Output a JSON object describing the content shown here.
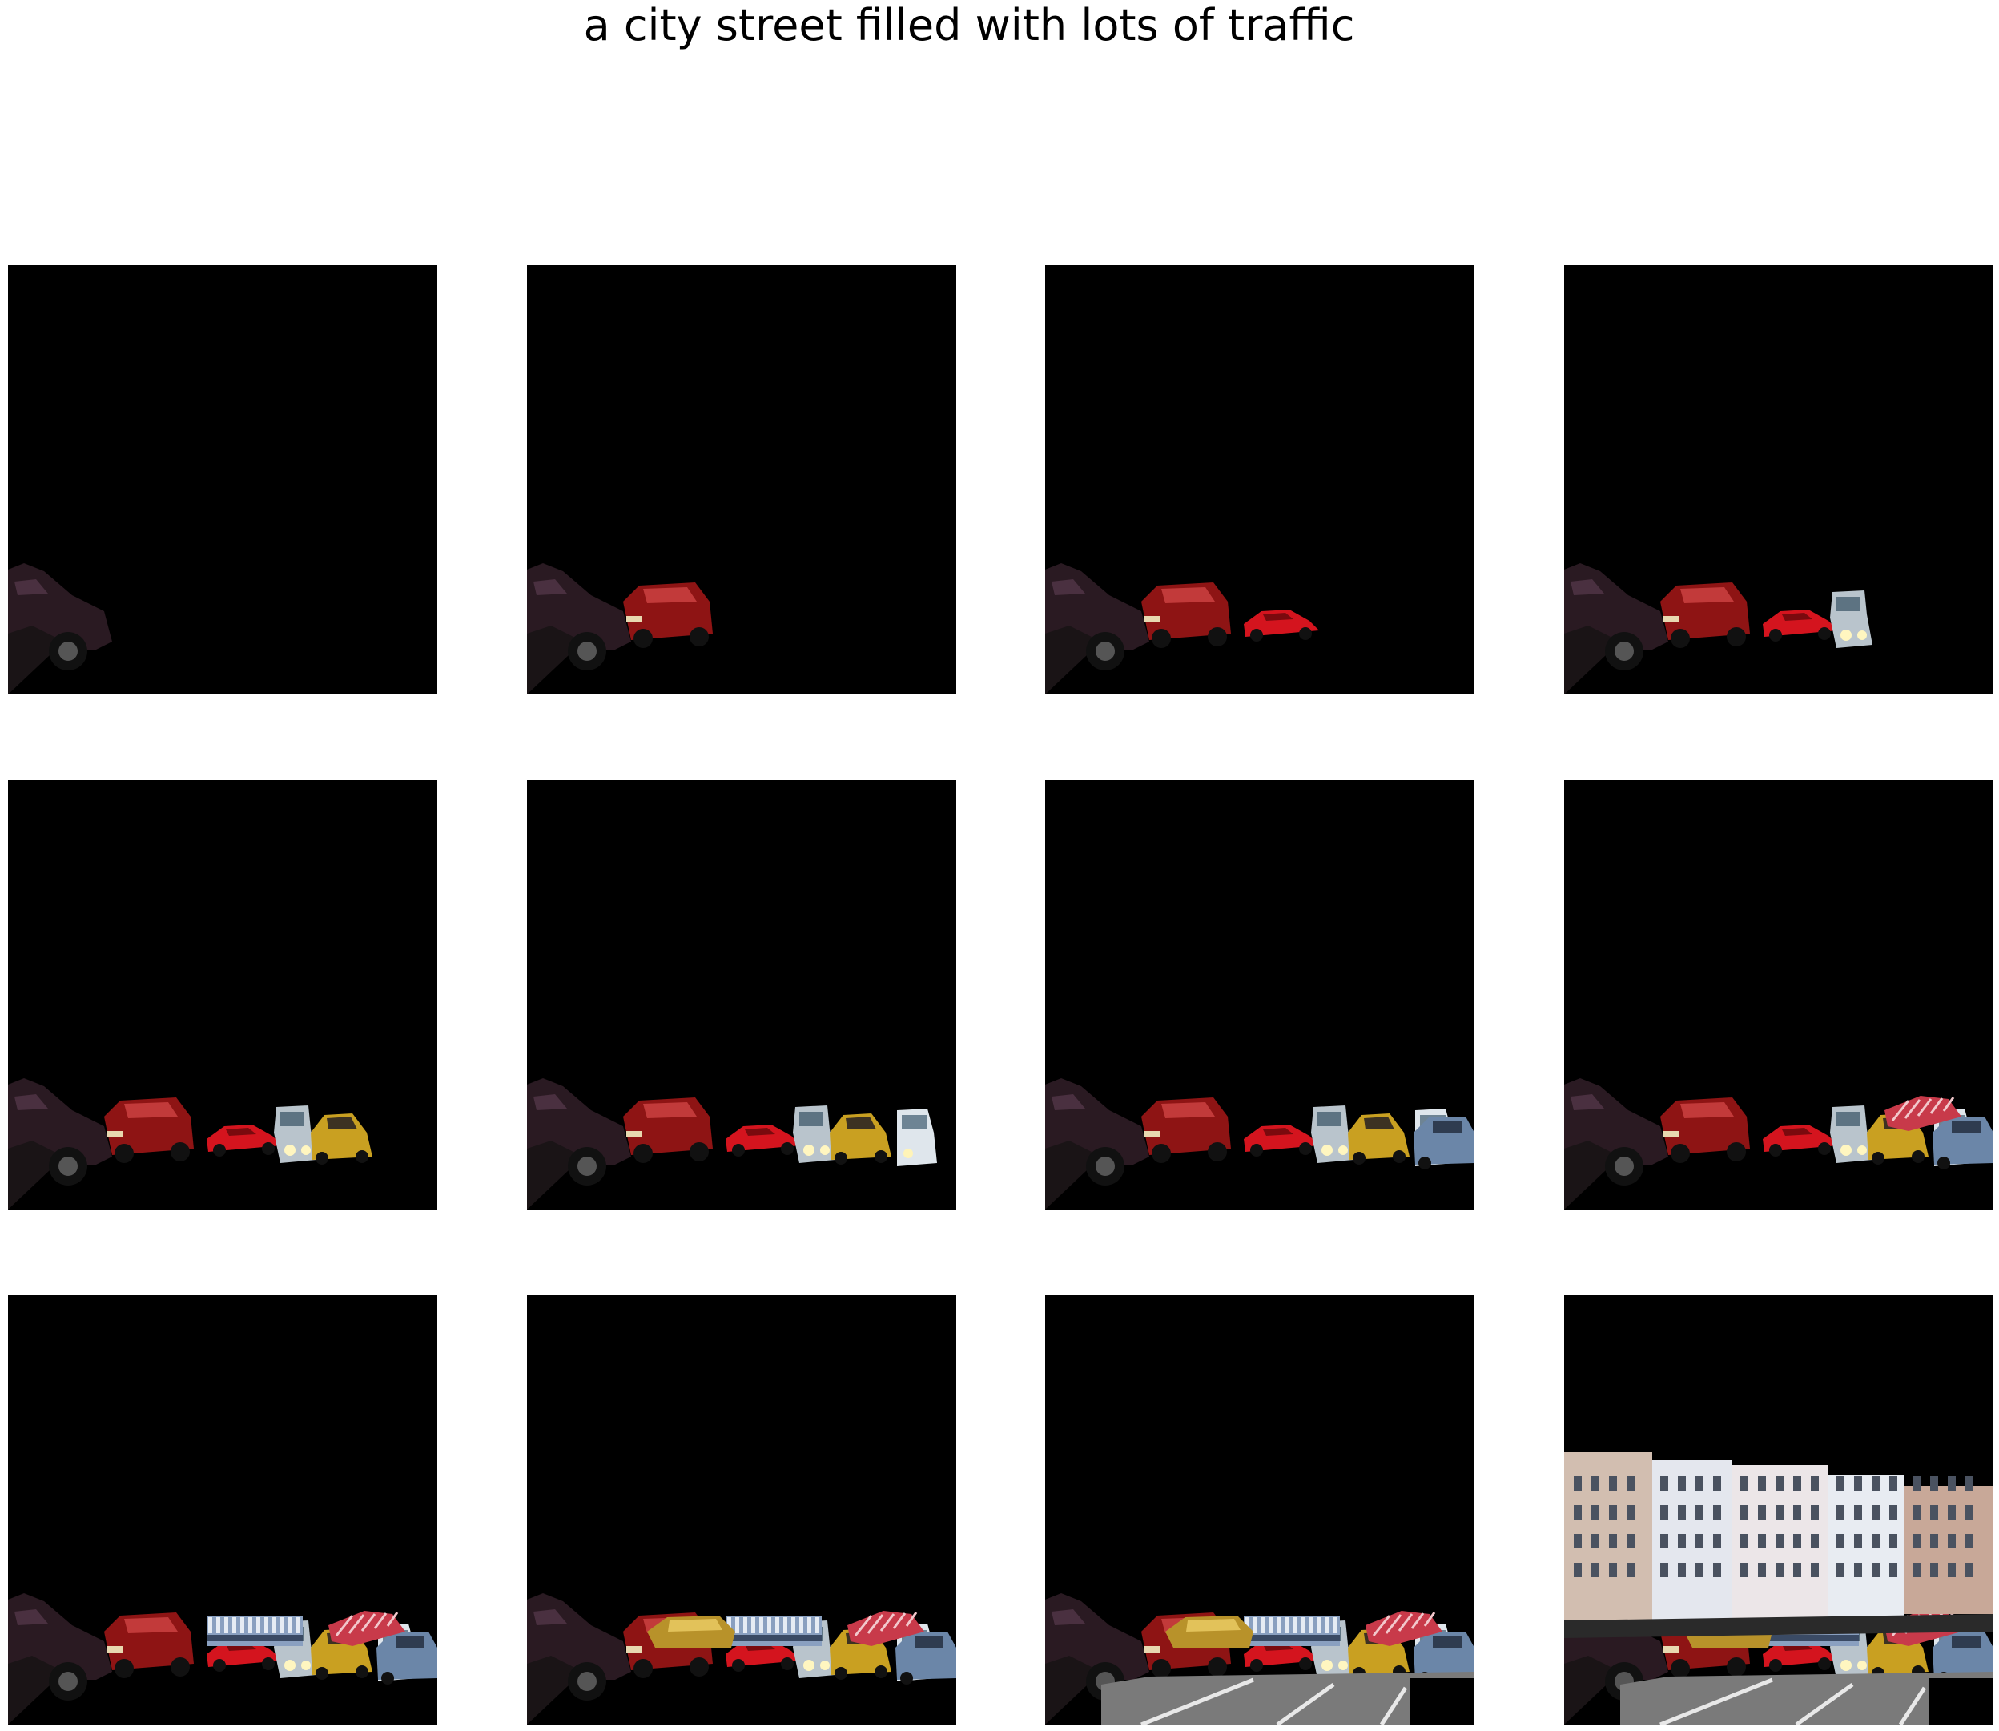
{
  "caption": "a city street filled with lots of traffic",
  "grid": {
    "rows": 3,
    "columns": 4,
    "panel_background": "#000000",
    "page_background": "#ffffff"
  },
  "panels": [
    {
      "step": 1,
      "layers": [
        "dark-suv"
      ]
    },
    {
      "step": 2,
      "layers": [
        "dark-suv",
        "red-suv"
      ]
    },
    {
      "step": 3,
      "layers": [
        "dark-suv",
        "red-suv",
        "red-sports-car"
      ]
    },
    {
      "step": 4,
      "layers": [
        "dark-suv",
        "red-suv",
        "red-sports-car",
        "silver-van"
      ]
    },
    {
      "step": 5,
      "layers": [
        "dark-suv",
        "red-suv",
        "red-sports-car",
        "silver-van",
        "yellow-car"
      ]
    },
    {
      "step": 6,
      "layers": [
        "dark-suv",
        "red-suv",
        "red-sports-car",
        "silver-van",
        "yellow-car",
        "white-van"
      ]
    },
    {
      "step": 7,
      "layers": [
        "dark-suv",
        "red-suv",
        "red-sports-car",
        "silver-van",
        "yellow-car",
        "white-van",
        "blue-car"
      ]
    },
    {
      "step": 8,
      "layers": [
        "dark-suv",
        "red-suv",
        "red-sports-car",
        "silver-van",
        "yellow-car",
        "white-van",
        "blue-car",
        "red-striped-truck"
      ]
    },
    {
      "step": 9,
      "layers": [
        "dark-suv",
        "red-suv",
        "red-sports-car",
        "silver-van",
        "yellow-car",
        "white-van",
        "blue-car",
        "red-striped-truck",
        "striped-bus"
      ]
    },
    {
      "step": 10,
      "layers": [
        "dark-suv",
        "red-suv",
        "red-sports-car",
        "silver-van",
        "yellow-car",
        "white-van",
        "blue-car",
        "red-striped-truck",
        "striped-bus",
        "yellow-roof-car"
      ]
    },
    {
      "step": 11,
      "layers": [
        "dark-suv",
        "red-suv",
        "red-sports-car",
        "silver-van",
        "yellow-car",
        "white-van",
        "blue-car",
        "red-striped-truck",
        "striped-bus",
        "yellow-roof-car",
        "road"
      ]
    },
    {
      "step": 12,
      "layers": [
        "dark-suv",
        "red-suv",
        "red-sports-car",
        "silver-van",
        "yellow-car",
        "white-van",
        "blue-car",
        "red-striped-truck",
        "striped-bus",
        "yellow-roof-car",
        "road",
        "buildings"
      ]
    }
  ]
}
